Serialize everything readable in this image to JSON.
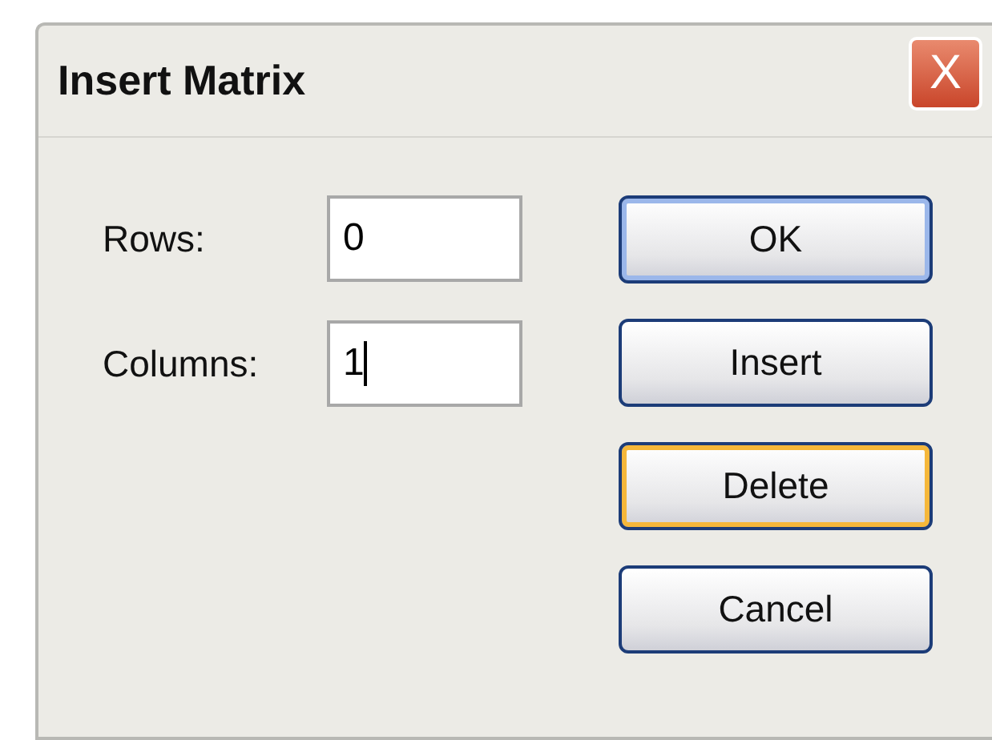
{
  "window": {
    "title": "Insert Matrix",
    "close_label": "X"
  },
  "fields": [
    {
      "label": "Rows:",
      "value": "0",
      "focused": false
    },
    {
      "label": "Columns:",
      "value": "1",
      "focused": true
    }
  ],
  "buttons": [
    {
      "label": "OK",
      "default": true,
      "hovered": false
    },
    {
      "label": "Insert",
      "default": false,
      "hovered": false
    },
    {
      "label": "Delete",
      "default": false,
      "hovered": true
    },
    {
      "label": "Cancel",
      "default": false,
      "hovered": false
    }
  ]
}
